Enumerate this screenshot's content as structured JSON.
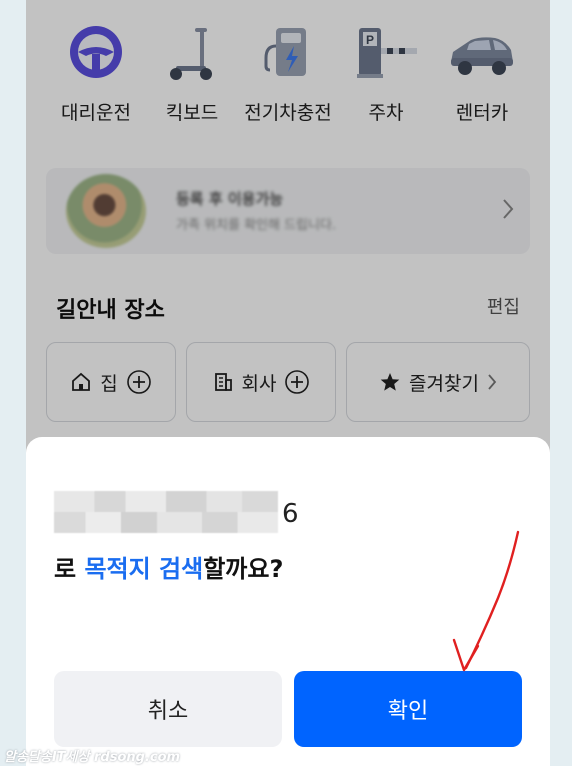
{
  "services": [
    {
      "label": "대리운전",
      "icon": "steering-wheel-icon"
    },
    {
      "label": "킥보드",
      "icon": "kickboard-icon"
    },
    {
      "label": "전기차충전",
      "icon": "ev-charger-icon"
    },
    {
      "label": "주차",
      "icon": "parking-gate-icon"
    },
    {
      "label": "렌터카",
      "icon": "car-icon"
    }
  ],
  "banner": {
    "title": "등록 후 이용가능",
    "subtitle": "가족 위치를 확인해 드립니다."
  },
  "favorites": {
    "title": "길안내 장소",
    "edit_label": "편집",
    "places": [
      {
        "label": "집"
      },
      {
        "label": "회사"
      },
      {
        "label": "즐겨찾기"
      }
    ]
  },
  "dialog": {
    "address_suffix": "6",
    "question_prefix": "로 ",
    "question_highlight": "목적지 검색",
    "question_suffix": "할까요?",
    "cancel_label": "취소",
    "confirm_label": "확인"
  },
  "colors": {
    "accent": "#0064ff",
    "highlight_text": "#1a6df0",
    "annotation_arrow": "#e02020"
  },
  "watermark": "알송달송IT세상 rdsong.com"
}
